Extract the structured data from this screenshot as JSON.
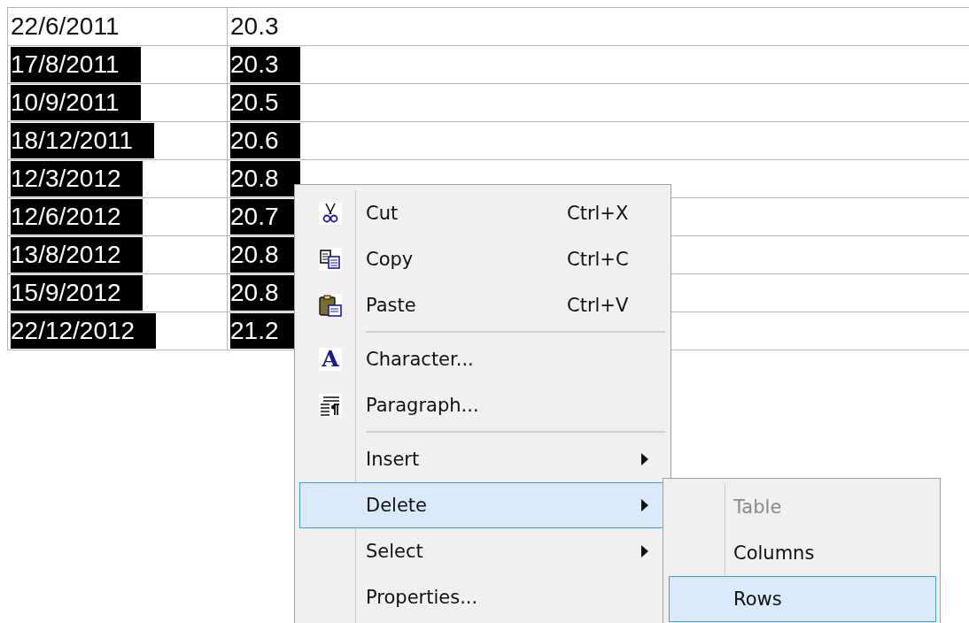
{
  "table": {
    "rows": [
      {
        "cells": [
          "22/6/2011",
          "20.3"
        ],
        "selected": false
      },
      {
        "cells": [
          "17/8/2011",
          "20.3"
        ],
        "selected": true
      },
      {
        "cells": [
          "10/9/2011",
          "20.5"
        ],
        "selected": true
      },
      {
        "cells": [
          "18/12/2011",
          "20.6"
        ],
        "selected": true
      },
      {
        "cells": [
          "12/3/2012",
          "20.8"
        ],
        "selected": true
      },
      {
        "cells": [
          "12/6/2012",
          "20.7"
        ],
        "selected": true
      },
      {
        "cells": [
          "13/8/2012",
          "20.8"
        ],
        "selected": true
      },
      {
        "cells": [
          "15/9/2012",
          "20.8"
        ],
        "selected": true
      },
      {
        "cells": [
          "22/12/2012",
          "21.2"
        ],
        "selected": true
      }
    ]
  },
  "context_menu": {
    "groups": [
      [
        {
          "label": "Cut",
          "shortcut": "Ctrl+X",
          "kind": "cut",
          "selected": false
        },
        {
          "label": "Copy",
          "shortcut": "Ctrl+C",
          "kind": "copy",
          "selected": false
        },
        {
          "label": "Paste",
          "shortcut": "Ctrl+V",
          "kind": "paste",
          "selected": false
        }
      ],
      [
        {
          "label": "Character...",
          "kind": "glyph",
          "glyph": "A",
          "selected": false
        },
        {
          "label": "Paragraph...",
          "kind": "paragraph",
          "selected": false
        }
      ],
      [
        {
          "label": "Insert",
          "kind": "submenu",
          "selected": false
        },
        {
          "label": "Delete",
          "kind": "submenu",
          "selected": true
        },
        {
          "label": "Select",
          "kind": "submenu",
          "selected": false
        },
        {
          "label": "Properties...",
          "kind": "plain",
          "selected": false
        }
      ]
    ]
  },
  "submenu": {
    "items": [
      {
        "label": "Table",
        "disabled": true,
        "selected": false
      },
      {
        "label": "Columns",
        "disabled": false,
        "selected": false
      },
      {
        "label": "Rows",
        "disabled": false,
        "selected": true
      }
    ]
  }
}
